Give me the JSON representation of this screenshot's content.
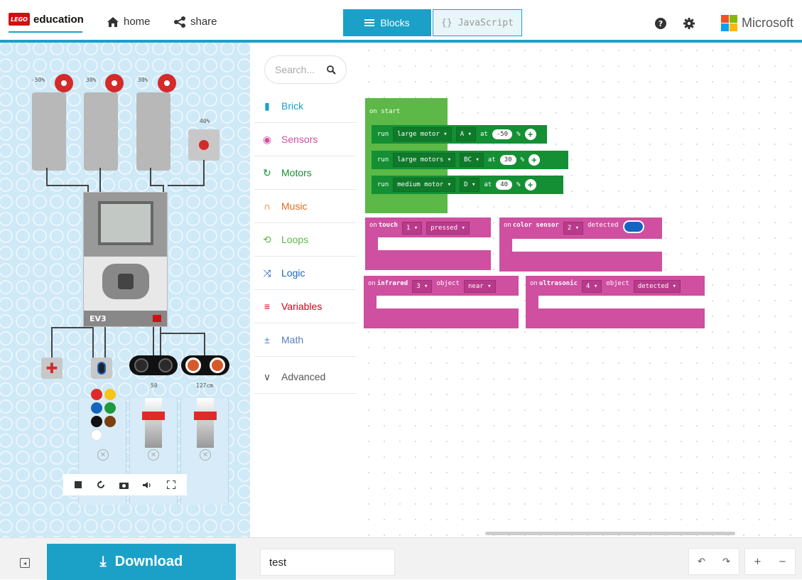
{
  "header": {
    "brand_box": "LEGO",
    "brand_text": "education",
    "home_label": "home",
    "share_label": "share",
    "tab_blocks": "Blocks",
    "tab_js_icon": "{}",
    "tab_js": "JavaScript",
    "ms_label": "Microsoft",
    "active_tab": "Blocks",
    "accent_color": "#1ba1c8"
  },
  "simulator": {
    "motor_a_pct": "-50%",
    "motor_b_pct": "30%",
    "motor_c_pct": "30%",
    "motor_d_pct": "40%",
    "brick_label": "EV3",
    "infrared_value": "50",
    "ultrasonic_value": "127cm",
    "color_options": [
      "#e02a2a",
      "#f5c518",
      "#1565c0",
      "#1e9a3c",
      "#111111",
      "#7b3f12",
      "#ffffff"
    ],
    "infrared_level": 0.5,
    "ultrasonic_level": 0.5,
    "toolbar_icons": [
      "stop-icon",
      "restart-icon",
      "screenshot-icon",
      "sound-icon",
      "fullscreen-icon"
    ]
  },
  "toolbox": {
    "search_placeholder": "Search...",
    "categories": [
      {
        "label": "Brick",
        "color": "#1ba1c8",
        "icon": "brick-icon"
      },
      {
        "label": "Sensors",
        "color": "#cf4fa0",
        "icon": "sensors-icon"
      },
      {
        "label": "Motors",
        "color": "#148f34",
        "icon": "motors-icon"
      },
      {
        "label": "Music",
        "color": "#e06c1c",
        "icon": "music-icon"
      },
      {
        "label": "Loops",
        "color": "#5cb947",
        "icon": "loops-icon"
      },
      {
        "label": "Logic",
        "color": "#1565c0",
        "icon": "logic-icon"
      },
      {
        "label": "Variables",
        "color": "#d0021b",
        "icon": "variables-icon"
      },
      {
        "label": "Math",
        "color": "#5a7dbd",
        "icon": "math-icon"
      },
      {
        "label": "Advanced",
        "color": "#555555",
        "icon": "advanced-icon"
      }
    ],
    "search_icon": "🔍",
    "brick_icon": "▮",
    "sensors_icon": "◉",
    "motors_icon": "↻",
    "music_icon": "∩",
    "loops_icon": "⟲",
    "logic_icon": "⤨",
    "variables_icon": "≡",
    "math_icon": "±",
    "advanced_icon": "∨"
  },
  "workspace": {
    "on_start": "on start",
    "run": "run",
    "at": "at",
    "pct": "%",
    "row1": {
      "motor": "large motor ▾",
      "port": "A ▾",
      "speed": "-50"
    },
    "row2": {
      "motor": "large motors ▾",
      "port": "BC ▾",
      "speed": "30"
    },
    "row3": {
      "motor": "medium motor ▾",
      "port": "D ▾",
      "speed": "40"
    },
    "touch": {
      "on": "on",
      "name": "touch",
      "port": "1 ▾",
      "event": "pressed ▾"
    },
    "color_sensor": {
      "on": "on",
      "name": "color sensor",
      "port": "2 ▾",
      "event": "detected"
    },
    "infrared": {
      "on": "on",
      "name": "infrared",
      "port": "3 ▾",
      "object": "object",
      "value": "near ▾"
    },
    "ultrasonic": {
      "on": "on",
      "name": "ultrasonic",
      "port": "4 ▾",
      "object": "object",
      "value": "detected ▾"
    },
    "plus_icon": "+"
  },
  "bottom": {
    "download_label": "Download",
    "download_icon": "⤓",
    "project_name": "test",
    "undo_icon": "↶",
    "redo_icon": "↷",
    "zoom_in_icon": "+",
    "zoom_out_icon": "−",
    "collapse_icon": "◂"
  }
}
